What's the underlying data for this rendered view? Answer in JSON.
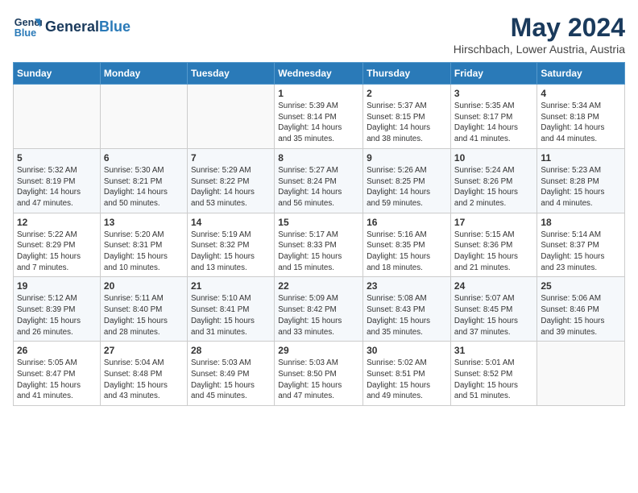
{
  "header": {
    "logo_line1": "General",
    "logo_line2": "Blue",
    "main_title": "May 2024",
    "subtitle": "Hirschbach, Lower Austria, Austria"
  },
  "days_of_week": [
    "Sunday",
    "Monday",
    "Tuesday",
    "Wednesday",
    "Thursday",
    "Friday",
    "Saturday"
  ],
  "weeks": [
    [
      {
        "day": "",
        "info": ""
      },
      {
        "day": "",
        "info": ""
      },
      {
        "day": "",
        "info": ""
      },
      {
        "day": "1",
        "info": "Sunrise: 5:39 AM\nSunset: 8:14 PM\nDaylight: 14 hours\nand 35 minutes."
      },
      {
        "day": "2",
        "info": "Sunrise: 5:37 AM\nSunset: 8:15 PM\nDaylight: 14 hours\nand 38 minutes."
      },
      {
        "day": "3",
        "info": "Sunrise: 5:35 AM\nSunset: 8:17 PM\nDaylight: 14 hours\nand 41 minutes."
      },
      {
        "day": "4",
        "info": "Sunrise: 5:34 AM\nSunset: 8:18 PM\nDaylight: 14 hours\nand 44 minutes."
      }
    ],
    [
      {
        "day": "5",
        "info": "Sunrise: 5:32 AM\nSunset: 8:19 PM\nDaylight: 14 hours\nand 47 minutes."
      },
      {
        "day": "6",
        "info": "Sunrise: 5:30 AM\nSunset: 8:21 PM\nDaylight: 14 hours\nand 50 minutes."
      },
      {
        "day": "7",
        "info": "Sunrise: 5:29 AM\nSunset: 8:22 PM\nDaylight: 14 hours\nand 53 minutes."
      },
      {
        "day": "8",
        "info": "Sunrise: 5:27 AM\nSunset: 8:24 PM\nDaylight: 14 hours\nand 56 minutes."
      },
      {
        "day": "9",
        "info": "Sunrise: 5:26 AM\nSunset: 8:25 PM\nDaylight: 14 hours\nand 59 minutes."
      },
      {
        "day": "10",
        "info": "Sunrise: 5:24 AM\nSunset: 8:26 PM\nDaylight: 15 hours\nand 2 minutes."
      },
      {
        "day": "11",
        "info": "Sunrise: 5:23 AM\nSunset: 8:28 PM\nDaylight: 15 hours\nand 4 minutes."
      }
    ],
    [
      {
        "day": "12",
        "info": "Sunrise: 5:22 AM\nSunset: 8:29 PM\nDaylight: 15 hours\nand 7 minutes."
      },
      {
        "day": "13",
        "info": "Sunrise: 5:20 AM\nSunset: 8:31 PM\nDaylight: 15 hours\nand 10 minutes."
      },
      {
        "day": "14",
        "info": "Sunrise: 5:19 AM\nSunset: 8:32 PM\nDaylight: 15 hours\nand 13 minutes."
      },
      {
        "day": "15",
        "info": "Sunrise: 5:17 AM\nSunset: 8:33 PM\nDaylight: 15 hours\nand 15 minutes."
      },
      {
        "day": "16",
        "info": "Sunrise: 5:16 AM\nSunset: 8:35 PM\nDaylight: 15 hours\nand 18 minutes."
      },
      {
        "day": "17",
        "info": "Sunrise: 5:15 AM\nSunset: 8:36 PM\nDaylight: 15 hours\nand 21 minutes."
      },
      {
        "day": "18",
        "info": "Sunrise: 5:14 AM\nSunset: 8:37 PM\nDaylight: 15 hours\nand 23 minutes."
      }
    ],
    [
      {
        "day": "19",
        "info": "Sunrise: 5:12 AM\nSunset: 8:39 PM\nDaylight: 15 hours\nand 26 minutes."
      },
      {
        "day": "20",
        "info": "Sunrise: 5:11 AM\nSunset: 8:40 PM\nDaylight: 15 hours\nand 28 minutes."
      },
      {
        "day": "21",
        "info": "Sunrise: 5:10 AM\nSunset: 8:41 PM\nDaylight: 15 hours\nand 31 minutes."
      },
      {
        "day": "22",
        "info": "Sunrise: 5:09 AM\nSunset: 8:42 PM\nDaylight: 15 hours\nand 33 minutes."
      },
      {
        "day": "23",
        "info": "Sunrise: 5:08 AM\nSunset: 8:43 PM\nDaylight: 15 hours\nand 35 minutes."
      },
      {
        "day": "24",
        "info": "Sunrise: 5:07 AM\nSunset: 8:45 PM\nDaylight: 15 hours\nand 37 minutes."
      },
      {
        "day": "25",
        "info": "Sunrise: 5:06 AM\nSunset: 8:46 PM\nDaylight: 15 hours\nand 39 minutes."
      }
    ],
    [
      {
        "day": "26",
        "info": "Sunrise: 5:05 AM\nSunset: 8:47 PM\nDaylight: 15 hours\nand 41 minutes."
      },
      {
        "day": "27",
        "info": "Sunrise: 5:04 AM\nSunset: 8:48 PM\nDaylight: 15 hours\nand 43 minutes."
      },
      {
        "day": "28",
        "info": "Sunrise: 5:03 AM\nSunset: 8:49 PM\nDaylight: 15 hours\nand 45 minutes."
      },
      {
        "day": "29",
        "info": "Sunrise: 5:03 AM\nSunset: 8:50 PM\nDaylight: 15 hours\nand 47 minutes."
      },
      {
        "day": "30",
        "info": "Sunrise: 5:02 AM\nSunset: 8:51 PM\nDaylight: 15 hours\nand 49 minutes."
      },
      {
        "day": "31",
        "info": "Sunrise: 5:01 AM\nSunset: 8:52 PM\nDaylight: 15 hours\nand 51 minutes."
      },
      {
        "day": "",
        "info": ""
      }
    ]
  ]
}
